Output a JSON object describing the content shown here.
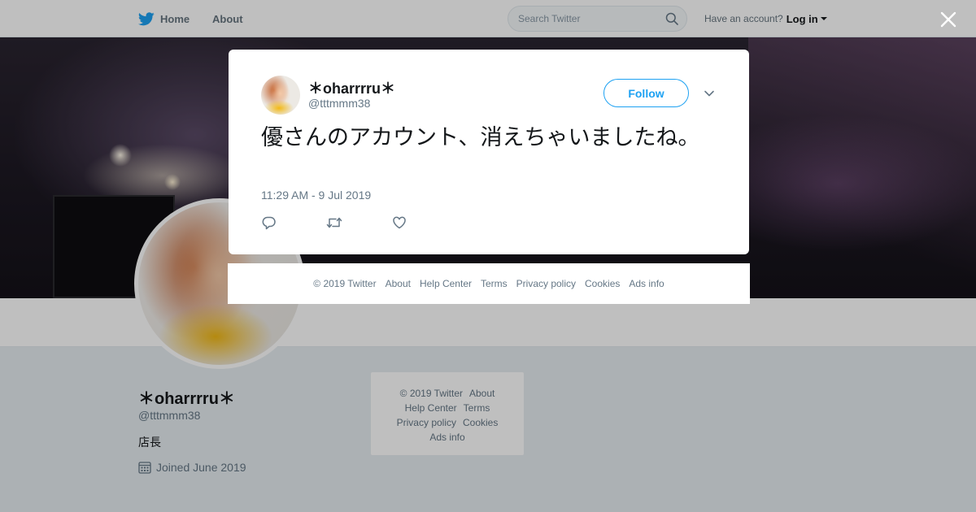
{
  "topbar": {
    "home_label": "Home",
    "about_label": "About",
    "search_placeholder": "Search Twitter",
    "account_prompt": "Have an account?",
    "login_label": "Log in"
  },
  "profile": {
    "name": "＊oharrrru＊",
    "handle": "@tttmmm38",
    "bio": "店長",
    "joined": "Joined June 2019"
  },
  "side_footer": {
    "copyright": "© 2019 Twitter",
    "about": "About",
    "help": "Help Center",
    "terms": "Terms",
    "privacy": "Privacy policy",
    "cookies": "Cookies",
    "ads": "Ads info"
  },
  "tweet": {
    "author_name": "＊oharrrru＊",
    "author_handle": "@tttmmm38",
    "follow_label": "Follow",
    "text": "優さんのアカウント、消えちゃいましたね。",
    "timestamp": "11:29 AM - 9 Jul 2019"
  },
  "modal_footer": {
    "copyright": "© 2019 Twitter",
    "about": "About",
    "help": "Help Center",
    "terms": "Terms",
    "privacy": "Privacy policy",
    "cookies": "Cookies",
    "ads": "Ads info"
  },
  "icons": {
    "brand": "twitter-bird-icon",
    "search": "search-icon",
    "close": "close-icon",
    "more": "chevron-down-icon",
    "reply": "reply-icon",
    "retweet": "retweet-icon",
    "like": "heart-icon",
    "calendar": "calendar-icon"
  },
  "colors": {
    "brand_blue": "#1da1f2",
    "muted_text": "#657786",
    "page_bg": "#e6ecf0"
  }
}
